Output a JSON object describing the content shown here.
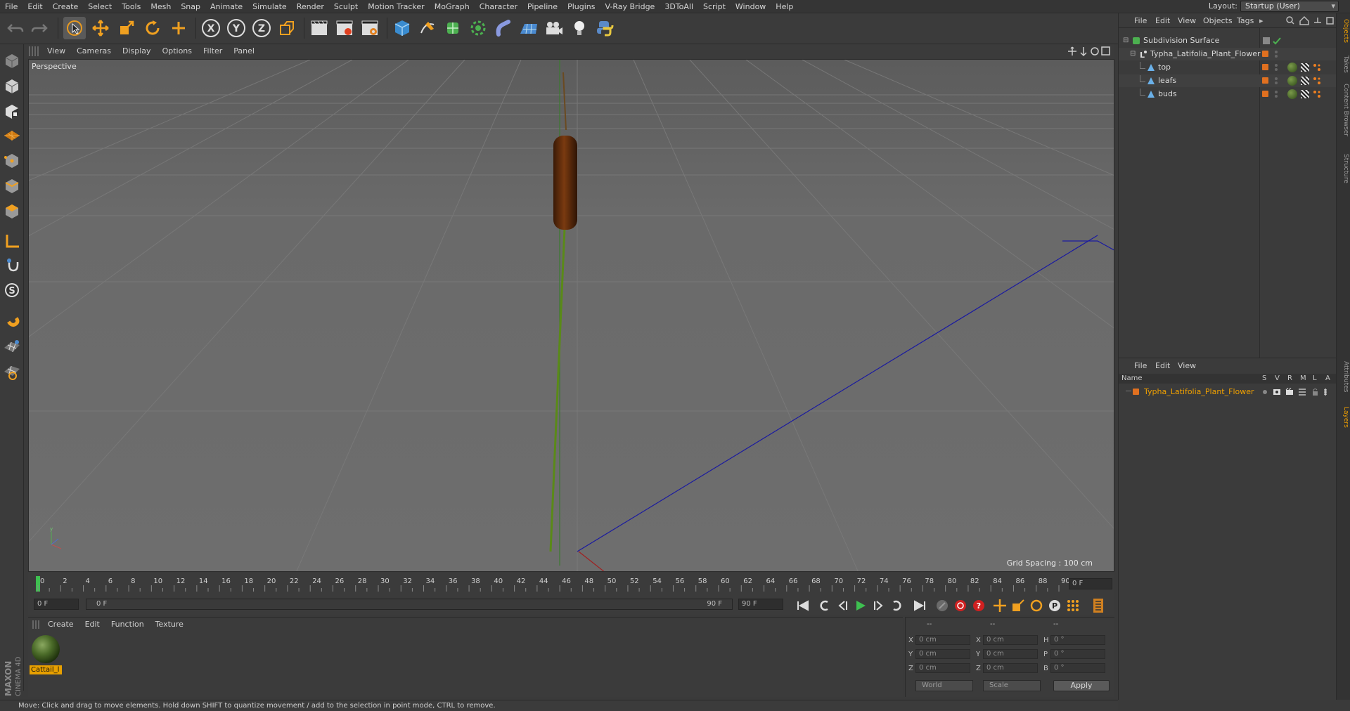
{
  "menu": {
    "items": [
      "File",
      "Edit",
      "Create",
      "Select",
      "Tools",
      "Mesh",
      "Snap",
      "Animate",
      "Simulate",
      "Render",
      "Sculpt",
      "Motion Tracker",
      "MoGraph",
      "Character",
      "Pipeline",
      "Plugins",
      "V-Ray Bridge",
      "3DToAll",
      "Script",
      "Window",
      "Help"
    ],
    "layout_label": "Layout:",
    "layout_value": "Startup (User)"
  },
  "toolbar": {
    "icons": [
      "undo-icon",
      "redo-icon",
      "select-pointer-icon",
      "move-icon",
      "scale-icon",
      "rotate-icon",
      "live-add-icon",
      "axis-x-icon",
      "axis-y-icon",
      "axis-z-icon",
      "coordinate-system-icon",
      "render-view-icon",
      "render-picture-viewer-icon",
      "render-settings-icon",
      "cube-primitive-icon",
      "pen-spline-icon",
      "subdivision-icon",
      "array-icon",
      "deformer-icon",
      "floor-icon",
      "camera-icon",
      "light-icon",
      "python-icon"
    ],
    "axis_x": "X",
    "axis_y": "Y",
    "axis_z": "Z"
  },
  "left_tools": [
    "make-editable-icon",
    "model-mode-icon",
    "texture-mode-icon",
    "workplane-icon",
    "points-mode-icon",
    "edges-mode-icon",
    "polygons-mode-icon",
    "axis-mode-icon",
    "tweak-icon",
    "solo-icon",
    "magnet-icon",
    "snap-grid-icon",
    "snap-settings-icon"
  ],
  "viewport": {
    "menu": [
      "View",
      "Cameras",
      "Display",
      "Options",
      "Filter",
      "Panel"
    ],
    "label": "Perspective",
    "grid_spacing": "Grid Spacing : 100 cm"
  },
  "timeline": {
    "ticks": [
      "0",
      "2",
      "4",
      "6",
      "8",
      "10",
      "12",
      "14",
      "16",
      "18",
      "20",
      "22",
      "24",
      "26",
      "28",
      "30",
      "32",
      "34",
      "36",
      "38",
      "40",
      "42",
      "44",
      "46",
      "48",
      "50",
      "52",
      "54",
      "56",
      "58",
      "60",
      "62",
      "64",
      "66",
      "68",
      "70",
      "72",
      "74",
      "76",
      "78",
      "80",
      "82",
      "84",
      "86",
      "88",
      "90"
    ],
    "current_frame_field": "0 F",
    "start_field": "0 F",
    "range_start": "0 F",
    "range_end": "90 F",
    "end_field": "90 F"
  },
  "material_manager": {
    "menu": [
      "Create",
      "Edit",
      "Function",
      "Texture"
    ],
    "material_name": "Cattail_l"
  },
  "coordinates": {
    "headers": [
      "--",
      "--",
      "--"
    ],
    "rows": [
      {
        "a": "X",
        "av": "0 cm",
        "b": "X",
        "bv": "0 cm",
        "c": "H",
        "cv": "0 °"
      },
      {
        "a": "Y",
        "av": "0 cm",
        "b": "Y",
        "bv": "0 cm",
        "c": "P",
        "cv": "0 °"
      },
      {
        "a": "Z",
        "av": "0 cm",
        "b": "Z",
        "bv": "0 cm",
        "c": "B",
        "cv": "0 °"
      }
    ],
    "mode_world": "World",
    "mode_scale": "Scale",
    "apply": "Apply"
  },
  "object_manager": {
    "menu": [
      "File",
      "Edit",
      "View",
      "Objects",
      "Tags"
    ],
    "objects": [
      {
        "name": "Subdivision Surface"
      },
      {
        "name": "Typha_Latifolia_Plant_Flower"
      },
      {
        "name": "top"
      },
      {
        "name": "leafs"
      },
      {
        "name": "buds"
      }
    ]
  },
  "layers": {
    "menu": [
      "File",
      "Edit",
      "View"
    ],
    "columns": [
      "Name",
      "S",
      "V",
      "R",
      "M",
      "L",
      "A"
    ],
    "items": [
      {
        "name": "Typha_Latifolia_Plant_Flower",
        "color": "#e07020"
      }
    ]
  },
  "right_tabs": [
    "Objects",
    "Takes",
    "Content Browser",
    "Structure",
    "Attributes",
    "Layers"
  ],
  "status": "Move: Click and drag to move elements. Hold down SHIFT to quantize movement / add to the selection in point mode, CTRL to remove.",
  "brand": {
    "logo_top": "MAXON",
    "logo_bottom": "CINEMA 4D"
  },
  "colors": {
    "accent": "#e8a000",
    "selection": "#f0a000",
    "object_orange": "#e07020"
  }
}
